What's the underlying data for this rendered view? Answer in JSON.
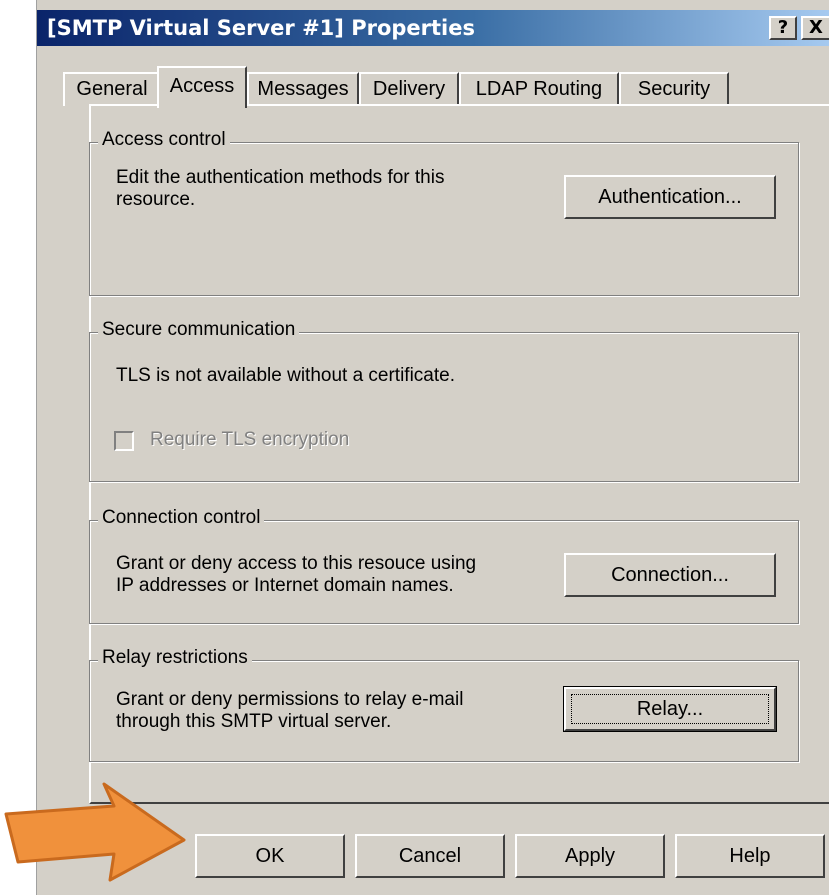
{
  "window": {
    "title": "[SMTP Virtual Server #1] Properties",
    "help_glyph": "?",
    "close_glyph": "X"
  },
  "tabs": [
    {
      "label": "General",
      "active": false
    },
    {
      "label": "Access",
      "active": true
    },
    {
      "label": "Messages",
      "active": false
    },
    {
      "label": "Delivery",
      "active": false
    },
    {
      "label": "LDAP Routing",
      "active": false
    },
    {
      "label": "Security",
      "active": false
    }
  ],
  "access_control": {
    "legend": "Access control",
    "description": "Edit the authentication methods for this resource.",
    "button_label": "Authentication..."
  },
  "secure_communication": {
    "legend": "Secure communication",
    "description": "TLS is not available without a certificate.",
    "checkbox_label": "Require TLS encryption",
    "checkbox_checked": false,
    "checkbox_enabled": false
  },
  "connection_control": {
    "legend": "Connection control",
    "description": "Grant or deny access to this resouce using IP addresses or Internet domain names.",
    "button_label": "Connection..."
  },
  "relay_restrictions": {
    "legend": "Relay restrictions",
    "description": "Grant or deny permissions to relay e-mail through this SMTP virtual server.",
    "button_label": "Relay..."
  },
  "footer": {
    "ok_label": "OK",
    "cancel_label": "Cancel",
    "apply_label": "Apply",
    "help_label": "Help"
  },
  "annotation": {
    "arrow_color": "#f0913c",
    "arrow_border": "#c96a1e",
    "icon": "arrow-right-icon"
  },
  "colors": {
    "dialog_face": "#d4d0c8",
    "title_start": "#0a246a",
    "title_end": "#a6caf0"
  }
}
